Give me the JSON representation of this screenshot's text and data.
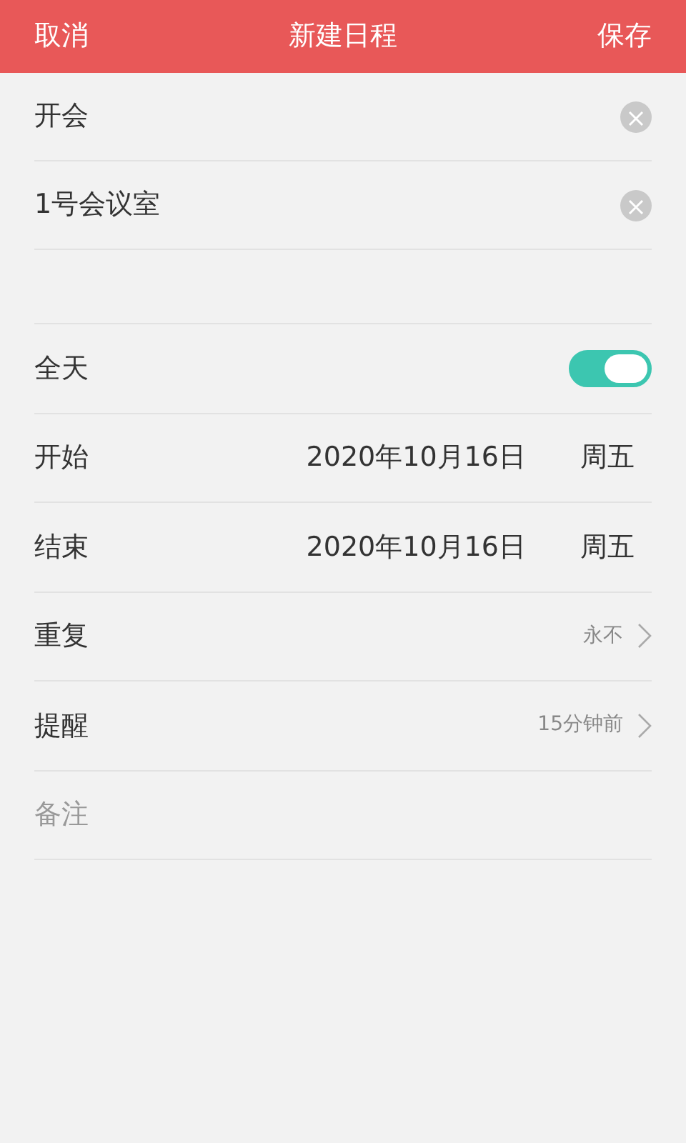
{
  "header": {
    "cancel": "取消",
    "title": "新建日程",
    "save": "保存"
  },
  "fields": [
    {
      "value": "开会"
    },
    {
      "value": "1号会议室"
    }
  ],
  "settings": [
    {
      "kind": "toggle",
      "label": "全天",
      "on": true
    },
    {
      "kind": "date",
      "label": "开始",
      "date": "2020年10月16日",
      "weekday": "周五"
    },
    {
      "kind": "date",
      "label": "结束",
      "date": "2020年10月16日",
      "weekday": "周五"
    },
    {
      "kind": "select",
      "label": "重复",
      "value": "永不"
    },
    {
      "kind": "select",
      "label": "提醒",
      "value": "15分钟前"
    }
  ],
  "notes": {
    "placeholder": "备注"
  }
}
